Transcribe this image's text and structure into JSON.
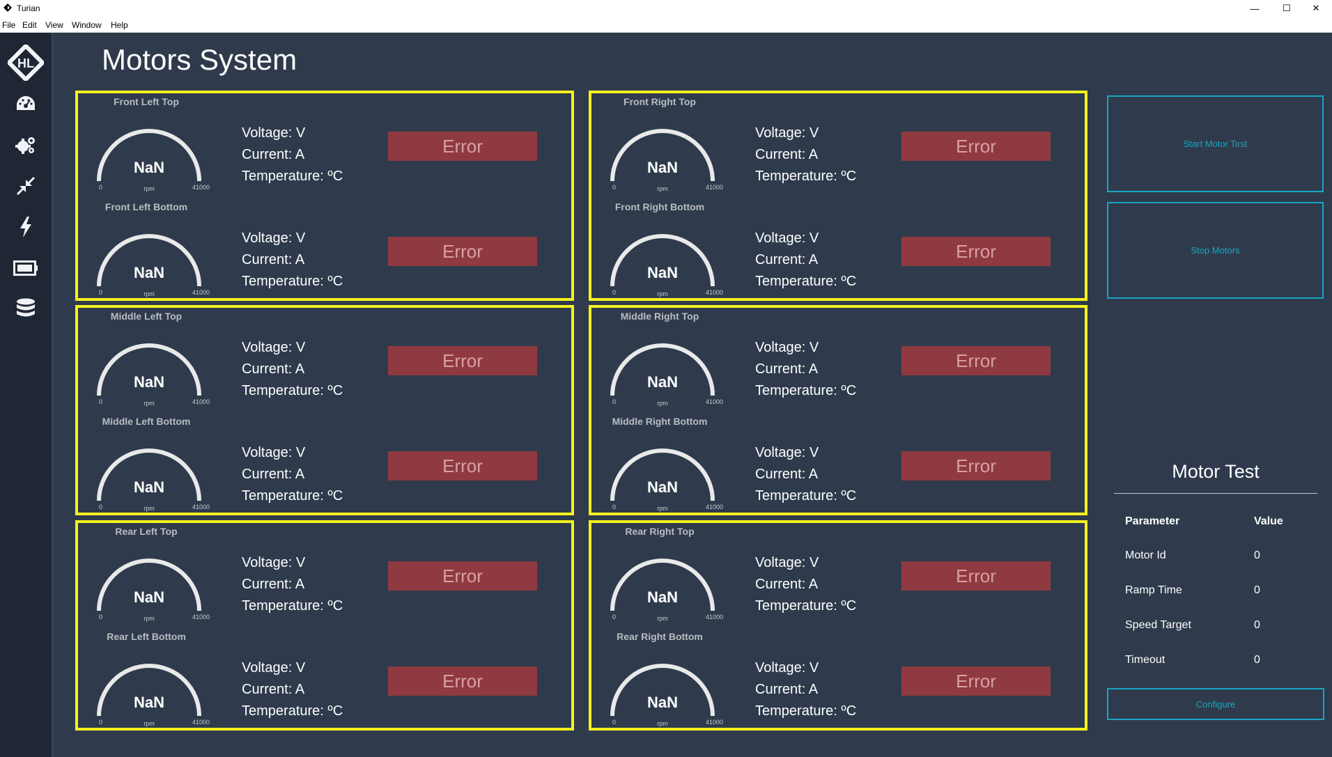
{
  "window": {
    "title": "Turian",
    "minimize_glyph": "—",
    "maximize_glyph": "☐",
    "close_glyph": "✕"
  },
  "menu": [
    "File",
    "Edit",
    "View",
    "Window",
    "Help"
  ],
  "nav_icons": [
    "hl-logo-icon",
    "dashboard-icon",
    "gears-icon",
    "compress-icon",
    "bolt-icon",
    "battery-icon",
    "database-icon"
  ],
  "page_title": "Motors System",
  "gauge_scale": {
    "min": "0",
    "max": "41000",
    "unit": "rpm"
  },
  "labels": {
    "voltage": "Voltage: V",
    "current": "Current: A",
    "temperature": "Temperature: ºC"
  },
  "panels": [
    {
      "motors": [
        {
          "name": "Front Left Top",
          "value": "NaN",
          "status": "Error"
        },
        {
          "name": "Front Left Bottom",
          "value": "NaN",
          "status": "Error"
        }
      ]
    },
    {
      "motors": [
        {
          "name": "Front Right Top",
          "value": "NaN",
          "status": "Error"
        },
        {
          "name": "Front Right Bottom",
          "value": "NaN",
          "status": "Error"
        }
      ]
    },
    {
      "motors": [
        {
          "name": "Middle Left Top",
          "value": "NaN",
          "status": "Error"
        },
        {
          "name": "Middle Left Bottom",
          "value": "NaN",
          "status": "Error"
        }
      ]
    },
    {
      "motors": [
        {
          "name": "Middle Right Top",
          "value": "NaN",
          "status": "Error"
        },
        {
          "name": "Middle Right Bottom",
          "value": "NaN",
          "status": "Error"
        }
      ]
    },
    {
      "motors": [
        {
          "name": "Rear Left Top",
          "value": "NaN",
          "status": "Error"
        },
        {
          "name": "Rear Left Bottom",
          "value": "NaN",
          "status": "Error"
        }
      ]
    },
    {
      "motors": [
        {
          "name": "Rear Right Top",
          "value": "NaN",
          "status": "Error"
        },
        {
          "name": "Rear Right Bottom",
          "value": "NaN",
          "status": "Error"
        }
      ]
    }
  ],
  "controls": {
    "start_label": "Start Motor Test",
    "stop_label": "Stop Motors",
    "configure_label": "Configure"
  },
  "motor_test": {
    "title": "Motor Test",
    "headers": [
      "Parameter",
      "Value"
    ],
    "rows": [
      {
        "param": "Motor Id",
        "value": "0"
      },
      {
        "param": "Ramp Time",
        "value": "0"
      },
      {
        "param": "Speed Target",
        "value": "0"
      },
      {
        "param": "Timeout",
        "value": "0"
      }
    ]
  },
  "colors": {
    "background": "#2f3b4c",
    "sidebar": "#1f2734",
    "panel_border": "#f4f21e",
    "error_bg": "#8f3a40",
    "accent": "#17a6c3"
  }
}
